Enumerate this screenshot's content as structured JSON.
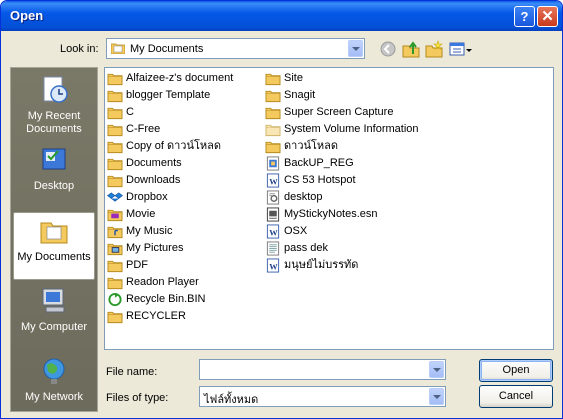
{
  "window": {
    "title": "Open"
  },
  "titlebar": {
    "help": "?",
    "close": "✕"
  },
  "lookin": {
    "label": "Look in:",
    "value": "My Documents"
  },
  "places": [
    {
      "id": "recent",
      "label": "My Recent\nDocuments"
    },
    {
      "id": "desktop",
      "label": "Desktop"
    },
    {
      "id": "documents",
      "label": "My Documents"
    },
    {
      "id": "computer",
      "label": "My Computer"
    },
    {
      "id": "network",
      "label": "My Network"
    }
  ],
  "files_col1": [
    {
      "name": "Alfaizee-z's document",
      "icon": "folder"
    },
    {
      "name": "blogger Template",
      "icon": "folder"
    },
    {
      "name": "C",
      "icon": "folder"
    },
    {
      "name": "C-Free",
      "icon": "folder"
    },
    {
      "name": "Copy of ดาวน์โหลด",
      "icon": "folder"
    },
    {
      "name": "Documents",
      "icon": "folder"
    },
    {
      "name": "Downloads",
      "icon": "folder"
    },
    {
      "name": "Dropbox",
      "icon": "dropbox"
    },
    {
      "name": "Movie",
      "icon": "folder-movie"
    },
    {
      "name": "My Music",
      "icon": "folder-music"
    },
    {
      "name": "My Pictures",
      "icon": "folder-pictures"
    },
    {
      "name": "PDF",
      "icon": "folder"
    },
    {
      "name": "Readon Player",
      "icon": "folder"
    },
    {
      "name": "Recycle Bin.BIN",
      "icon": "recycle"
    },
    {
      "name": "RECYCLER",
      "icon": "folder"
    }
  ],
  "files_col2": [
    {
      "name": "Site",
      "icon": "folder"
    },
    {
      "name": "Snagit",
      "icon": "folder"
    },
    {
      "name": "Super Screen Capture",
      "icon": "folder"
    },
    {
      "name": "System Volume Information",
      "icon": "folder-light"
    },
    {
      "name": "ดาวน์โหลด",
      "icon": "folder"
    },
    {
      "name": "BackUP_REG",
      "icon": "reg-file"
    },
    {
      "name": "CS 53 Hotspot",
      "icon": "word-doc"
    },
    {
      "name": "desktop",
      "icon": "ini-file"
    },
    {
      "name": "MyStickyNotes.esn",
      "icon": "esn-file"
    },
    {
      "name": "OSX",
      "icon": "word-doc"
    },
    {
      "name": "pass dek",
      "icon": "text-file"
    },
    {
      "name": "มนุษย์ไม่บรรทัด",
      "icon": "word-doc"
    }
  ],
  "filename": {
    "label": "File name:",
    "value": ""
  },
  "filetype": {
    "label": "Files of type:",
    "value": "ไฟล์ทั้งหมด"
  },
  "buttons": {
    "open": "Open",
    "cancel": "Cancel"
  },
  "colors": {
    "titlebar": "#0558e8",
    "folder": "#f4c95d",
    "dialog_bg": "#ece9d8",
    "places_bg": "#716f64"
  }
}
